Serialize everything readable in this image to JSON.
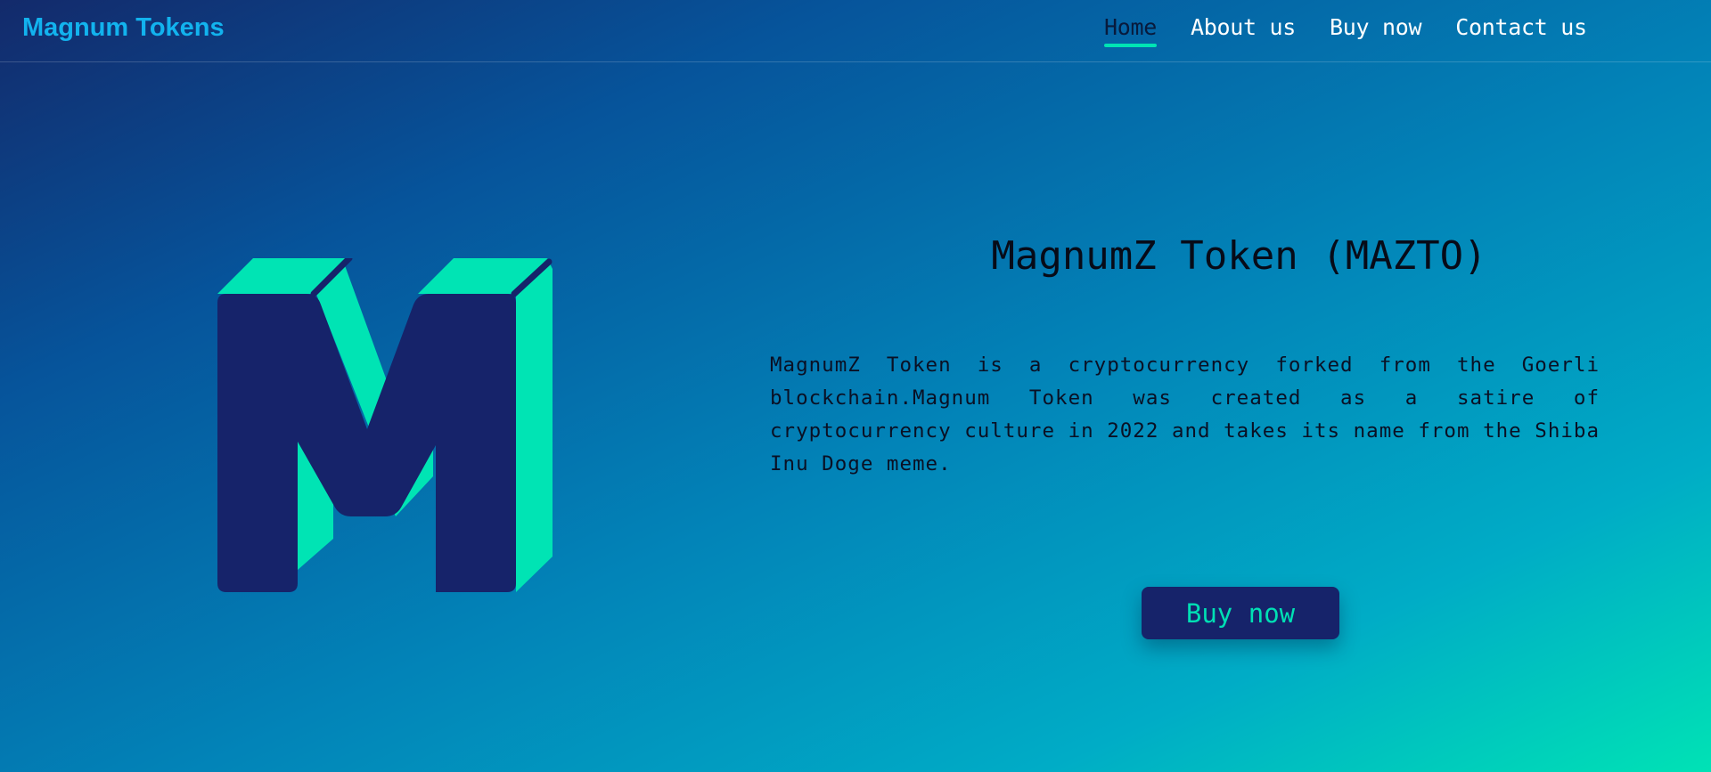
{
  "nav": {
    "brand": "Magnum Tokens",
    "links": [
      {
        "label": "Home",
        "active": true
      },
      {
        "label": "About us",
        "active": false
      },
      {
        "label": "Buy now",
        "active": false
      },
      {
        "label": "Contact us",
        "active": false
      }
    ]
  },
  "hero": {
    "logo_icon": "m-letter-3d-icon",
    "title": "MagnumZ Token (MAZTO)",
    "description": "MagnumZ Token is a cryptocurrency forked from the Goerli blockchain.Magnum Token was created as a satire of cryptocurrency culture in 2022 and takes its name from the Shiba Inu Doge meme.",
    "button_label": "Buy now"
  },
  "colors": {
    "accent": "#00e4b4",
    "dark_navy": "#16236a",
    "brand_text": "#12b3ee"
  }
}
